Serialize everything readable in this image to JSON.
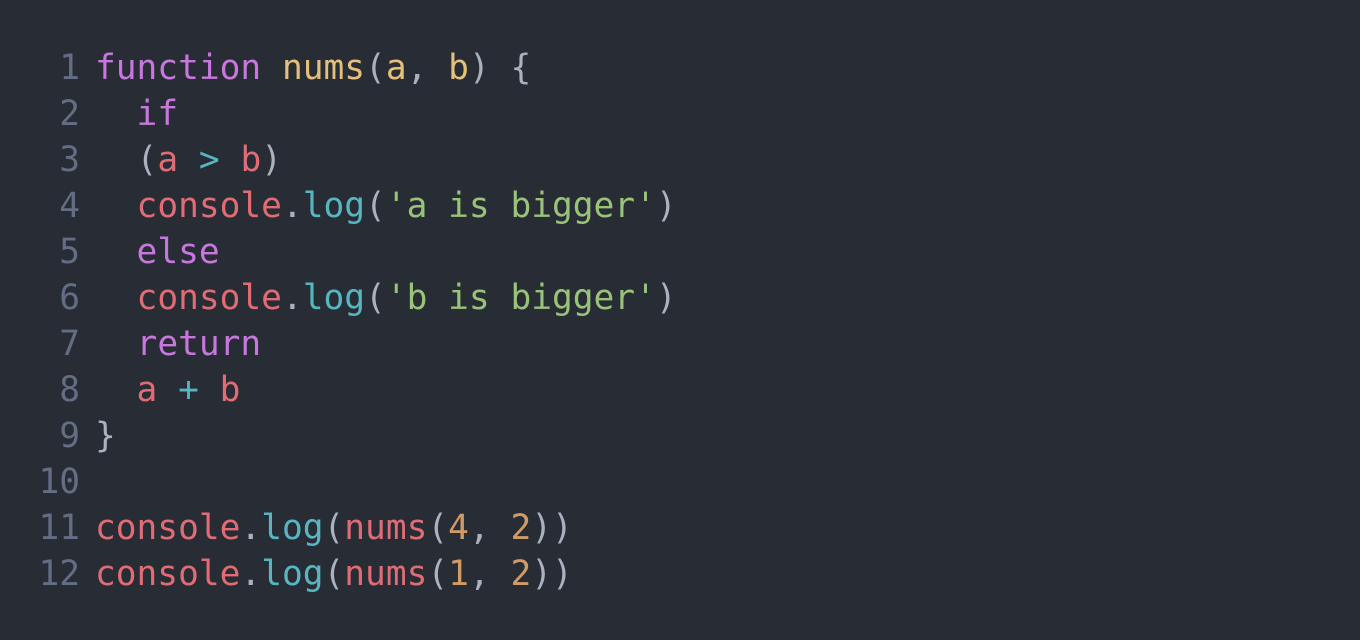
{
  "editor": {
    "lines": [
      {
        "number": "1",
        "tokens": [
          {
            "t": "function",
            "c": "kw"
          },
          {
            "t": " ",
            "c": "punc"
          },
          {
            "t": "nums",
            "c": "fn"
          },
          {
            "t": "(",
            "c": "punc"
          },
          {
            "t": "a",
            "c": "param"
          },
          {
            "t": ", ",
            "c": "punc"
          },
          {
            "t": "b",
            "c": "param"
          },
          {
            "t": ") {",
            "c": "punc"
          }
        ]
      },
      {
        "number": "2",
        "tokens": [
          {
            "t": "  ",
            "c": "punc"
          },
          {
            "t": "if",
            "c": "kw"
          }
        ]
      },
      {
        "number": "3",
        "tokens": [
          {
            "t": "  (",
            "c": "punc"
          },
          {
            "t": "a",
            "c": "var"
          },
          {
            "t": " ",
            "c": "punc"
          },
          {
            "t": ">",
            "c": "op"
          },
          {
            "t": " ",
            "c": "punc"
          },
          {
            "t": "b",
            "c": "var"
          },
          {
            "t": ")",
            "c": "punc"
          }
        ]
      },
      {
        "number": "4",
        "tokens": [
          {
            "t": "  ",
            "c": "punc"
          },
          {
            "t": "console",
            "c": "var"
          },
          {
            "t": ".",
            "c": "punc"
          },
          {
            "t": "log",
            "c": "meth"
          },
          {
            "t": "(",
            "c": "punc"
          },
          {
            "t": "'a is bigger'",
            "c": "str"
          },
          {
            "t": ")",
            "c": "punc"
          }
        ]
      },
      {
        "number": "5",
        "tokens": [
          {
            "t": "  ",
            "c": "punc"
          },
          {
            "t": "else",
            "c": "kw"
          }
        ]
      },
      {
        "number": "6",
        "tokens": [
          {
            "t": "  ",
            "c": "punc"
          },
          {
            "t": "console",
            "c": "var"
          },
          {
            "t": ".",
            "c": "punc"
          },
          {
            "t": "log",
            "c": "meth"
          },
          {
            "t": "(",
            "c": "punc"
          },
          {
            "t": "'b is bigger'",
            "c": "str"
          },
          {
            "t": ")",
            "c": "punc"
          }
        ]
      },
      {
        "number": "7",
        "tokens": [
          {
            "t": "  ",
            "c": "punc"
          },
          {
            "t": "return",
            "c": "kw"
          }
        ]
      },
      {
        "number": "8",
        "tokens": [
          {
            "t": "  ",
            "c": "punc"
          },
          {
            "t": "a",
            "c": "var"
          },
          {
            "t": " ",
            "c": "punc"
          },
          {
            "t": "+",
            "c": "op"
          },
          {
            "t": " ",
            "c": "punc"
          },
          {
            "t": "b",
            "c": "var"
          }
        ]
      },
      {
        "number": "9",
        "tokens": [
          {
            "t": "}",
            "c": "punc"
          }
        ]
      },
      {
        "number": "10",
        "tokens": []
      },
      {
        "number": "11",
        "tokens": [
          {
            "t": "console",
            "c": "var"
          },
          {
            "t": ".",
            "c": "punc"
          },
          {
            "t": "log",
            "c": "meth"
          },
          {
            "t": "(",
            "c": "punc"
          },
          {
            "t": "nums",
            "c": "call"
          },
          {
            "t": "(",
            "c": "punc"
          },
          {
            "t": "4",
            "c": "num"
          },
          {
            "t": ", ",
            "c": "punc"
          },
          {
            "t": "2",
            "c": "num"
          },
          {
            "t": "))",
            "c": "punc"
          }
        ]
      },
      {
        "number": "12",
        "tokens": [
          {
            "t": "console",
            "c": "var"
          },
          {
            "t": ".",
            "c": "punc"
          },
          {
            "t": "log",
            "c": "meth"
          },
          {
            "t": "(",
            "c": "punc"
          },
          {
            "t": "nums",
            "c": "call"
          },
          {
            "t": "(",
            "c": "punc"
          },
          {
            "t": "1",
            "c": "num"
          },
          {
            "t": ", ",
            "c": "punc"
          },
          {
            "t": "2",
            "c": "num"
          },
          {
            "t": "))",
            "c": "punc"
          }
        ]
      }
    ]
  },
  "colors": {
    "background": "#282c34",
    "line_number": "#636d83",
    "keyword": "#c678dd",
    "function_name": "#e5c07b",
    "variable": "#e06c75",
    "method": "#56b6c2",
    "string": "#98c379",
    "number": "#d19a66",
    "punctuation": "#abb2bf"
  }
}
